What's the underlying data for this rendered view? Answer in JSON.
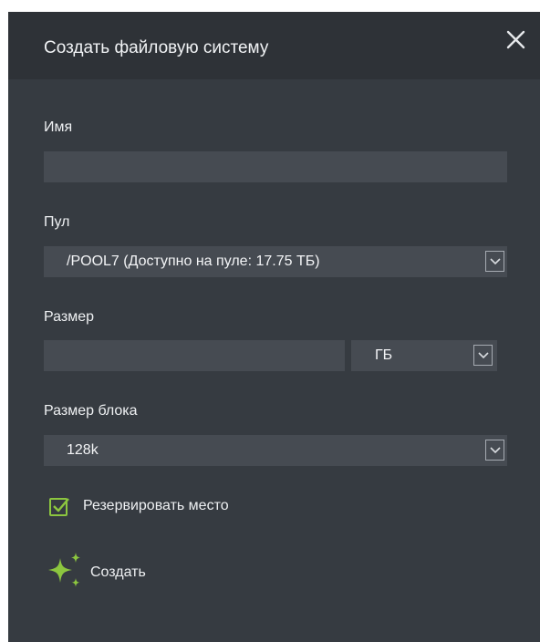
{
  "dialog": {
    "title": "Создать файловую систему",
    "close_icon": "close-icon"
  },
  "form": {
    "name": {
      "label": "Имя",
      "value": "",
      "placeholder": ""
    },
    "pool": {
      "label": "Пул",
      "selected": "/POOL7 (Доступно на пуле: 17.75 ТБ)"
    },
    "size": {
      "label": "Размер",
      "value": "",
      "unit_selected": "ГБ"
    },
    "block_size": {
      "label": "Размер блока",
      "selected": "128k"
    },
    "reserve": {
      "label": "Резервировать место",
      "checked": true
    }
  },
  "actions": {
    "create_label": "Создать",
    "create_icon": "sparkles-icon"
  },
  "colors": {
    "accent": "#8cc63f",
    "header_bg": "#2e3237",
    "dialog_bg": "#363b41",
    "field_bg": "#464b52"
  }
}
